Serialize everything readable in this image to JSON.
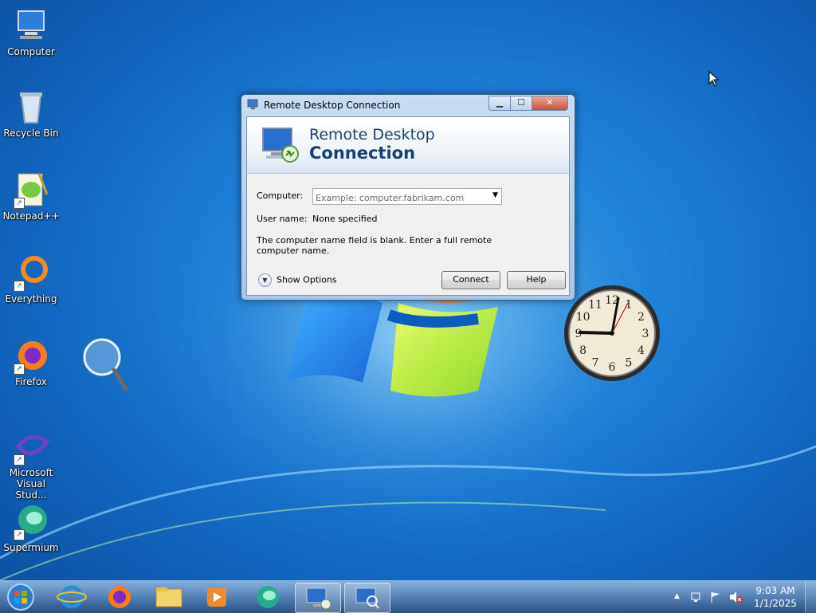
{
  "desktop": {
    "icons": [
      {
        "label": "Computer"
      },
      {
        "label": "Recycle Bin"
      },
      {
        "label": "Notepad++"
      },
      {
        "label": "Everything"
      },
      {
        "label": "Firefox"
      },
      {
        "label": "Microsoft Visual Stud..."
      },
      {
        "label": "Supermium"
      }
    ]
  },
  "window": {
    "title": "Remote Desktop Connection",
    "minimize_label": "▁",
    "maximize_label": "☐",
    "close_label": "✕",
    "banner_line1": "Remote Desktop",
    "banner_line2": "Connection",
    "computer_label": "Computer:",
    "computer_placeholder": "Example: computer.fabrikam.com",
    "computer_value": "",
    "username_label": "User name:",
    "username_value": "None specified",
    "message": "The computer name field is blank. Enter a full remote computer name.",
    "show_options_label": "Show Options",
    "connect_label": "Connect",
    "help_label": "Help"
  },
  "clock_gadget": {
    "numerals": [
      "12",
      "1",
      "2",
      "3",
      "4",
      "5",
      "6",
      "7",
      "8",
      "9",
      "10",
      "11"
    ],
    "time": "9:03"
  },
  "taskbar": {
    "pinned": [
      "start-orb-icon",
      "internet-explorer-icon",
      "firefox-icon",
      "file-explorer-icon",
      "media-player-icon",
      "supermium-icon",
      "remote-desktop-icon",
      "remote-desktop-search-icon"
    ],
    "tray_arrow": "▲",
    "time": "9:03 AM",
    "date": "1/1/2025"
  },
  "colors": {
    "desktop_blue": "#1e7fd6",
    "title_text": "#1a3e7a",
    "close_red": "#c7503a"
  }
}
